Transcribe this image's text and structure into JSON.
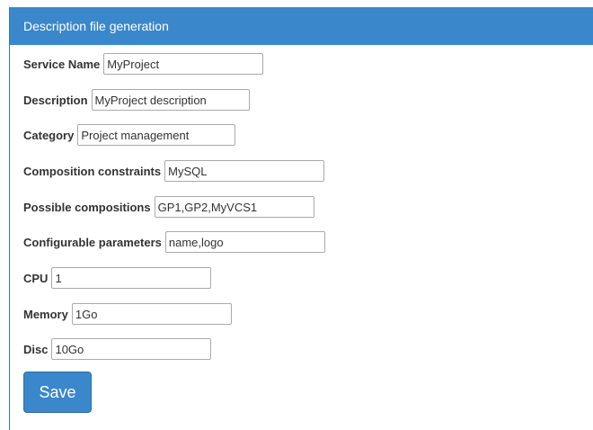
{
  "panel": {
    "title": "Description file generation"
  },
  "form": {
    "fields": [
      {
        "label": "Service Name",
        "value": "MyProject"
      },
      {
        "label": "Description",
        "value": "MyProject description"
      },
      {
        "label": "Category",
        "value": "Project management"
      },
      {
        "label": "Composition constraints",
        "value": "MySQL"
      },
      {
        "label": "Possible compositions",
        "value": "GP1,GP2,MyVCS1"
      },
      {
        "label": "Configurable parameters",
        "value": "name,logo"
      },
      {
        "label": "CPU",
        "value": "1"
      },
      {
        "label": "Memory",
        "value": "1Go"
      },
      {
        "label": "Disc",
        "value": "10Go"
      }
    ],
    "save_label": "Save"
  },
  "colors": {
    "header_bg": "#3a87cc",
    "button_bg": "#3a87cc",
    "header_text": "#ffffff"
  }
}
